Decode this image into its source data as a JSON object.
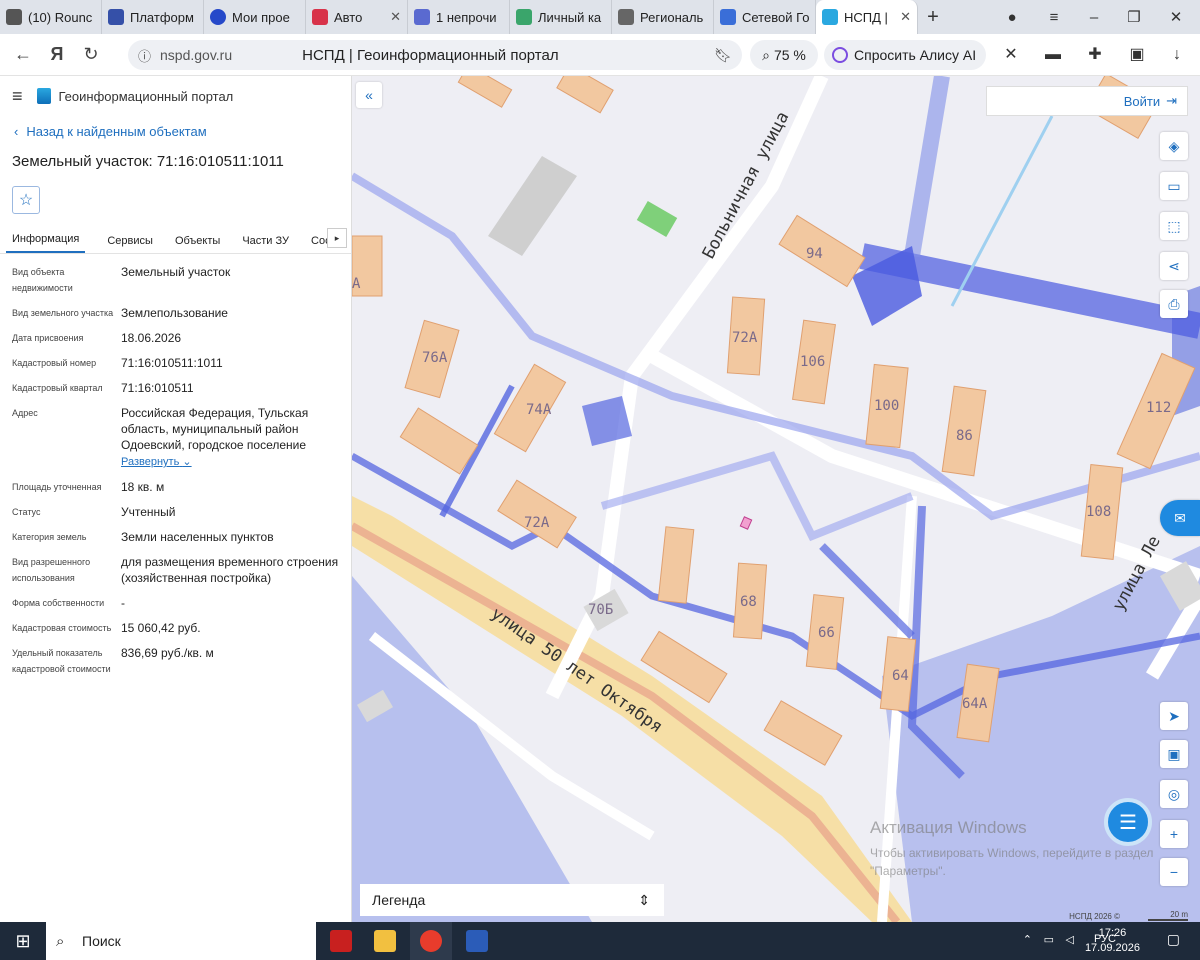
{
  "browser": {
    "tabs": [
      {
        "label": "(10) Rounc",
        "color": "#555"
      },
      {
        "label": "Платформ",
        "color": "#3550a8"
      },
      {
        "label": "Мои прое",
        "color": "#2649c9"
      },
      {
        "label": "Авто",
        "color": "#d8334a"
      },
      {
        "label": "1 непрочи",
        "color": "#5a6ad0"
      },
      {
        "label": "Личный ка",
        "color": "#3aa56b"
      },
      {
        "label": "Региональ",
        "color": "#666"
      },
      {
        "label": "Сетевой Го",
        "color": "#3a6ed8"
      },
      {
        "label": "НСПД |",
        "color": "#2aa8e0"
      }
    ],
    "url_host": "nspd.gov.ru",
    "page_title": "НСПД | Геоинформационный портал",
    "zoom": "75 %",
    "alice": "Спросить Алису AI"
  },
  "panel": {
    "portal_name": "Геоинформационный портал",
    "back_link": "Назад к найденным объектам",
    "object_title": "Земельный участок: 71:16:010511:1011",
    "tabs": [
      "Информация",
      "Сервисы",
      "Объекты",
      "Части ЗУ",
      "Состав"
    ],
    "rows": [
      {
        "k": "Вид объекта недвижимости",
        "v": "Земельный участок"
      },
      {
        "k": "Вид земельного участка",
        "v": "Землепользование"
      },
      {
        "k": "Дата присвоения",
        "v": "18.06.2026"
      },
      {
        "k": "Кадастровый номер",
        "v": "71:16:010511:1011"
      },
      {
        "k": "Кадастровый квартал",
        "v": "71:16:010511"
      },
      {
        "k": "Адрес",
        "v": "Российская Федерация, Тульская область, муниципальный район Одоевский, городское поселение",
        "link": "Развернуть"
      },
      {
        "k": "Площадь уточненная",
        "v": "18 кв. м"
      },
      {
        "k": "Статус",
        "v": "Учтенный"
      },
      {
        "k": "Категория земель",
        "v": "Земли населенных пунктов"
      },
      {
        "k": "Вид разрешенного использования",
        "v": "для размещения временного строения (хозяйственная постройка)"
      },
      {
        "k": "Форма собственности",
        "v": "-"
      },
      {
        "k": "Кадастровая стоимость",
        "v": "15 060,42 руб."
      },
      {
        "k": "Удельный показатель кадастровой стоимости",
        "v": "836,69 руб./кв. м"
      }
    ]
  },
  "map": {
    "login": "Войти",
    "legend": "Легенда",
    "attribution": "НСПД 2026 ©",
    "scale": "20 m",
    "street_labels": [
      "Больничная улица",
      "улица 50 лет Октября",
      "улица Ле"
    ],
    "house_numbers": [
      "94",
      "72А",
      "106",
      "100",
      "86",
      "112",
      "76А",
      "74А",
      "72А",
      "108",
      "70Б",
      "68",
      "66",
      "64",
      "64А",
      "А"
    ],
    "watermark_title": "Активация Windows",
    "watermark_text": "Чтобы активировать Windows, перейдите в раздел \"Параметры\"."
  },
  "taskbar": {
    "search": "Поиск",
    "lang": "РУС",
    "time": "17:26",
    "date": "17.09.2026"
  }
}
